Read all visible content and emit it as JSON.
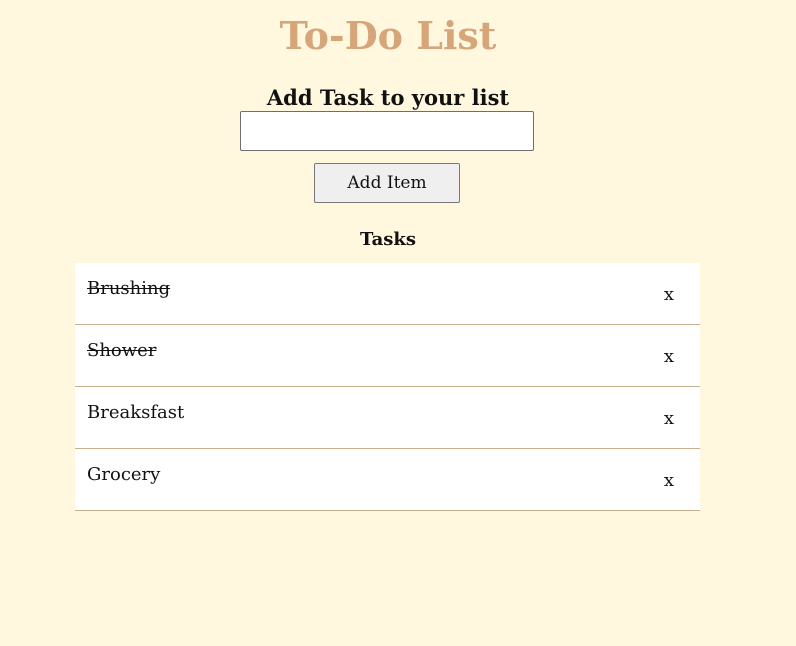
{
  "app": {
    "title": "To-Do List",
    "title_color": "#d6a57a",
    "background_color": "#fff8df"
  },
  "add_form": {
    "heading": "Add Task to your list",
    "input_value": "",
    "button_label": "Add Item"
  },
  "tasks": {
    "heading": "Tasks",
    "items": [
      {
        "label": "Brushing",
        "completed": true,
        "delete_label": "x"
      },
      {
        "label": "Shower",
        "completed": true,
        "delete_label": "x"
      },
      {
        "label": "Breaksfast",
        "completed": false,
        "delete_label": "x"
      },
      {
        "label": "Grocery",
        "completed": false,
        "delete_label": "x"
      }
    ]
  }
}
